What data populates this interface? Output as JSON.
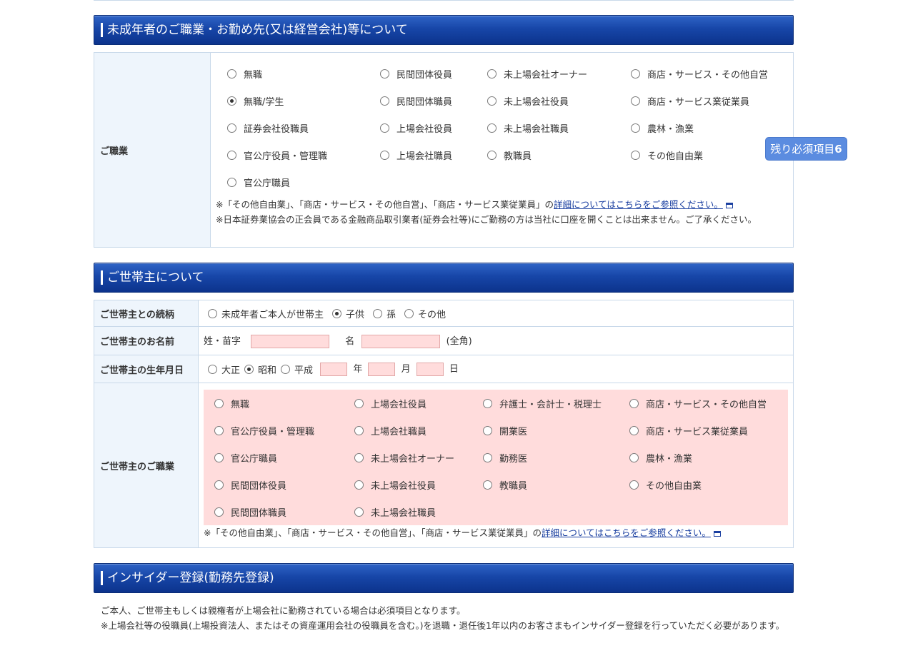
{
  "section1": {
    "title": "未成年者のご職業・お勤め先(又は経営会社)等について",
    "field_label": "ご職業",
    "options": [
      {
        "label": "無職",
        "checked": false
      },
      {
        "label": "民間団体役員",
        "checked": false
      },
      {
        "label": "未上場会社オーナー",
        "checked": false
      },
      {
        "label": "商店・サービス・その他自営",
        "checked": false
      },
      {
        "label": "無職/学生",
        "checked": true
      },
      {
        "label": "民間団体職員",
        "checked": false
      },
      {
        "label": "未上場会社役員",
        "checked": false
      },
      {
        "label": "商店・サービス業従業員",
        "checked": false
      },
      {
        "label": "証券会社役職員",
        "checked": false
      },
      {
        "label": "上場会社役員",
        "checked": false
      },
      {
        "label": "未上場会社職員",
        "checked": false
      },
      {
        "label": "農林・漁業",
        "checked": false
      },
      {
        "label": "官公庁役員・管理職",
        "checked": false
      },
      {
        "label": "上場会社職員",
        "checked": false
      },
      {
        "label": "教職員",
        "checked": false
      },
      {
        "label": "その他自由業",
        "checked": false
      },
      {
        "label": "官公庁職員",
        "checked": false
      }
    ],
    "note1_prefix": "※「その他自由業」、「商店・サービス・その他自営」、「商店・サービス業従業員」の",
    "note1_link": "詳細についてはこちらをご参照ください。",
    "note2": "※日本証券業協会の正会員である金融商品取引業者(証券会社等)にご勤務の方は当社に口座を開くことは出来ません。ご了承ください。"
  },
  "remaining_badge": {
    "label": "残り必須項目",
    "count": "6"
  },
  "section2": {
    "title": "ご世帯主について",
    "relation_label": "ご世帯主との続柄",
    "relation_options": [
      {
        "label": "未成年者ご本人が世帯主",
        "checked": false
      },
      {
        "label": "子供",
        "checked": true
      },
      {
        "label": "孫",
        "checked": false
      },
      {
        "label": "その他",
        "checked": false
      }
    ],
    "name_label": "ご世帯主のお名前",
    "surname_label": "姓・苗字",
    "given_label": "名",
    "fullwidth_hint": "(全角)",
    "birth_label": "ご世帯主の生年月日",
    "era_options": [
      {
        "label": "大正",
        "checked": false
      },
      {
        "label": "昭和",
        "checked": true
      },
      {
        "label": "平成",
        "checked": false
      }
    ],
    "year_unit": "年",
    "month_unit": "月",
    "day_unit": "日",
    "occupation_label": "ご世帯主のご職業",
    "occupation_options": [
      {
        "label": "無職",
        "checked": false
      },
      {
        "label": "上場会社役員",
        "checked": false
      },
      {
        "label": "弁護士・会計士・税理士",
        "checked": false
      },
      {
        "label": "商店・サービス・その他自営",
        "checked": false
      },
      {
        "label": "官公庁役員・管理職",
        "checked": false
      },
      {
        "label": "上場会社職員",
        "checked": false
      },
      {
        "label": "開業医",
        "checked": false
      },
      {
        "label": "商店・サービス業従業員",
        "checked": false
      },
      {
        "label": "官公庁職員",
        "checked": false
      },
      {
        "label": "未上場会社オーナー",
        "checked": false
      },
      {
        "label": "勤務医",
        "checked": false
      },
      {
        "label": "農林・漁業",
        "checked": false
      },
      {
        "label": "民間団体役員",
        "checked": false
      },
      {
        "label": "未上場会社役員",
        "checked": false
      },
      {
        "label": "教職員",
        "checked": false
      },
      {
        "label": "その他自由業",
        "checked": false
      },
      {
        "label": "民間団体職員",
        "checked": false
      },
      {
        "label": "未上場会社職員",
        "checked": false
      }
    ],
    "note_prefix": "※「その他自由業」、「商店・サービス・その他自営」、「商店・サービス業従業員」の",
    "note_link": "詳細についてはこちらをご参照ください。"
  },
  "section3": {
    "title": "インサイダー登録(勤務先登録)",
    "line1": "ご本人、ご世帯主もしくは親権者が上場会社に勤務されている場合は必須項目となります。",
    "line2": "※上場会社等の役職員(上場投資法人、またはその資産運用会社の役職員を含む。)を退職・退任後1年以内のお客さまもインサイダー登録を行っていただく必要があります。"
  }
}
